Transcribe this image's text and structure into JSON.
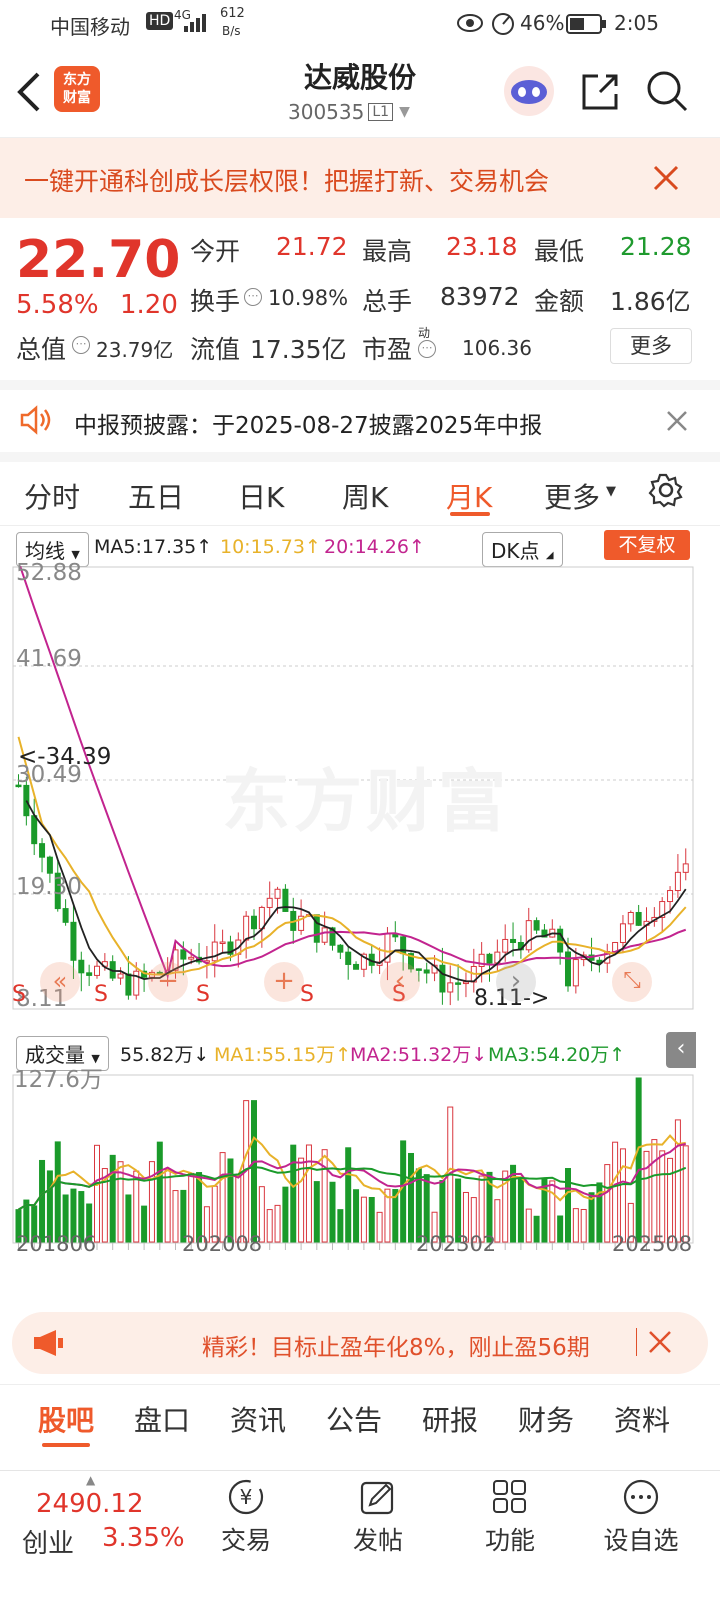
{
  "statusbar": {
    "carrier": "中国移动",
    "hd": "HD",
    "net": "4G",
    "speed_value": "612",
    "speed_unit": "B/s",
    "battery": "46%",
    "time": "2:05"
  },
  "header": {
    "logo_line1": "东方",
    "logo_line2": "财富",
    "stock_name": "达威股份",
    "stock_code": "300535",
    "level": "L1"
  },
  "banner": {
    "text": "一键开通科创成长层权限！把握打新、交易机会"
  },
  "quote": {
    "price": "22.70",
    "change_pct": "5.58%",
    "change": "1.20",
    "open_label": "今开",
    "open": "21.72",
    "high_label": "最高",
    "high": "23.18",
    "low_label": "最低",
    "low": "21.28",
    "turnover_label": "换手",
    "turnover": "10.98%",
    "volume_label": "总手",
    "volume": "83972",
    "amount_label": "金额",
    "amount": "1.86亿",
    "mktcap_label": "总值",
    "mktcap": "23.79亿",
    "float_label": "流值",
    "float": "17.35亿",
    "pe_label": "市盈",
    "pe_sup": "动",
    "pe": "106.36",
    "more_label": "更多"
  },
  "notice": {
    "text": "中报预披露：于2025-08-27披露2025年中报"
  },
  "tabs": [
    {
      "label": "分时"
    },
    {
      "label": "五日"
    },
    {
      "label": "日K"
    },
    {
      "label": "周K"
    },
    {
      "label": "月K"
    },
    {
      "label": "更多"
    }
  ],
  "chartbar": {
    "ma_selector": "均线",
    "ma5": "MA5:17.35↑",
    "ma10": "10:15.73↑",
    "ma20": "20:14.26↑",
    "dk": "DK点",
    "adjust": "不复权"
  },
  "kchart": {
    "y_labels": [
      "52.88",
      "41.69",
      "30.49",
      "19.30",
      "8.11"
    ],
    "high_note": "<-34.39",
    "low_note": "8.11->",
    "watermark": "东方财富",
    "markers": [
      "S",
      "S",
      "S",
      "S",
      "S"
    ],
    "colors": {
      "up": "#d9363e",
      "down": "#1a9a2a",
      "ma5": "#222222",
      "ma10": "#e8b22a",
      "ma20": "#c2248f"
    }
  },
  "volbar": {
    "label": "成交量",
    "value": "55.82万↓",
    "ma1": "MA1:55.15万↑",
    "ma2": "MA2:51.32万↓",
    "ma3": "MA3:54.20万↑"
  },
  "volchart": {
    "max_label": "127.6万",
    "x_labels": [
      "201806",
      "202008",
      "202302",
      "202508"
    ]
  },
  "promo": {
    "text": "精彩！目标止盈年化8%，刚止盈56期"
  },
  "subtabs": [
    {
      "label": "股吧"
    },
    {
      "label": "盘口"
    },
    {
      "label": "资讯"
    },
    {
      "label": "公告"
    },
    {
      "label": "研报"
    },
    {
      "label": "财务"
    },
    {
      "label": "资料"
    }
  ],
  "bottomnav": {
    "index_value": "2490.12",
    "index_name": "创业",
    "index_change": "3.35%",
    "items": [
      {
        "label": "交易"
      },
      {
        "label": "发帖"
      },
      {
        "label": "功能"
      },
      {
        "label": "设自选"
      }
    ]
  }
}
